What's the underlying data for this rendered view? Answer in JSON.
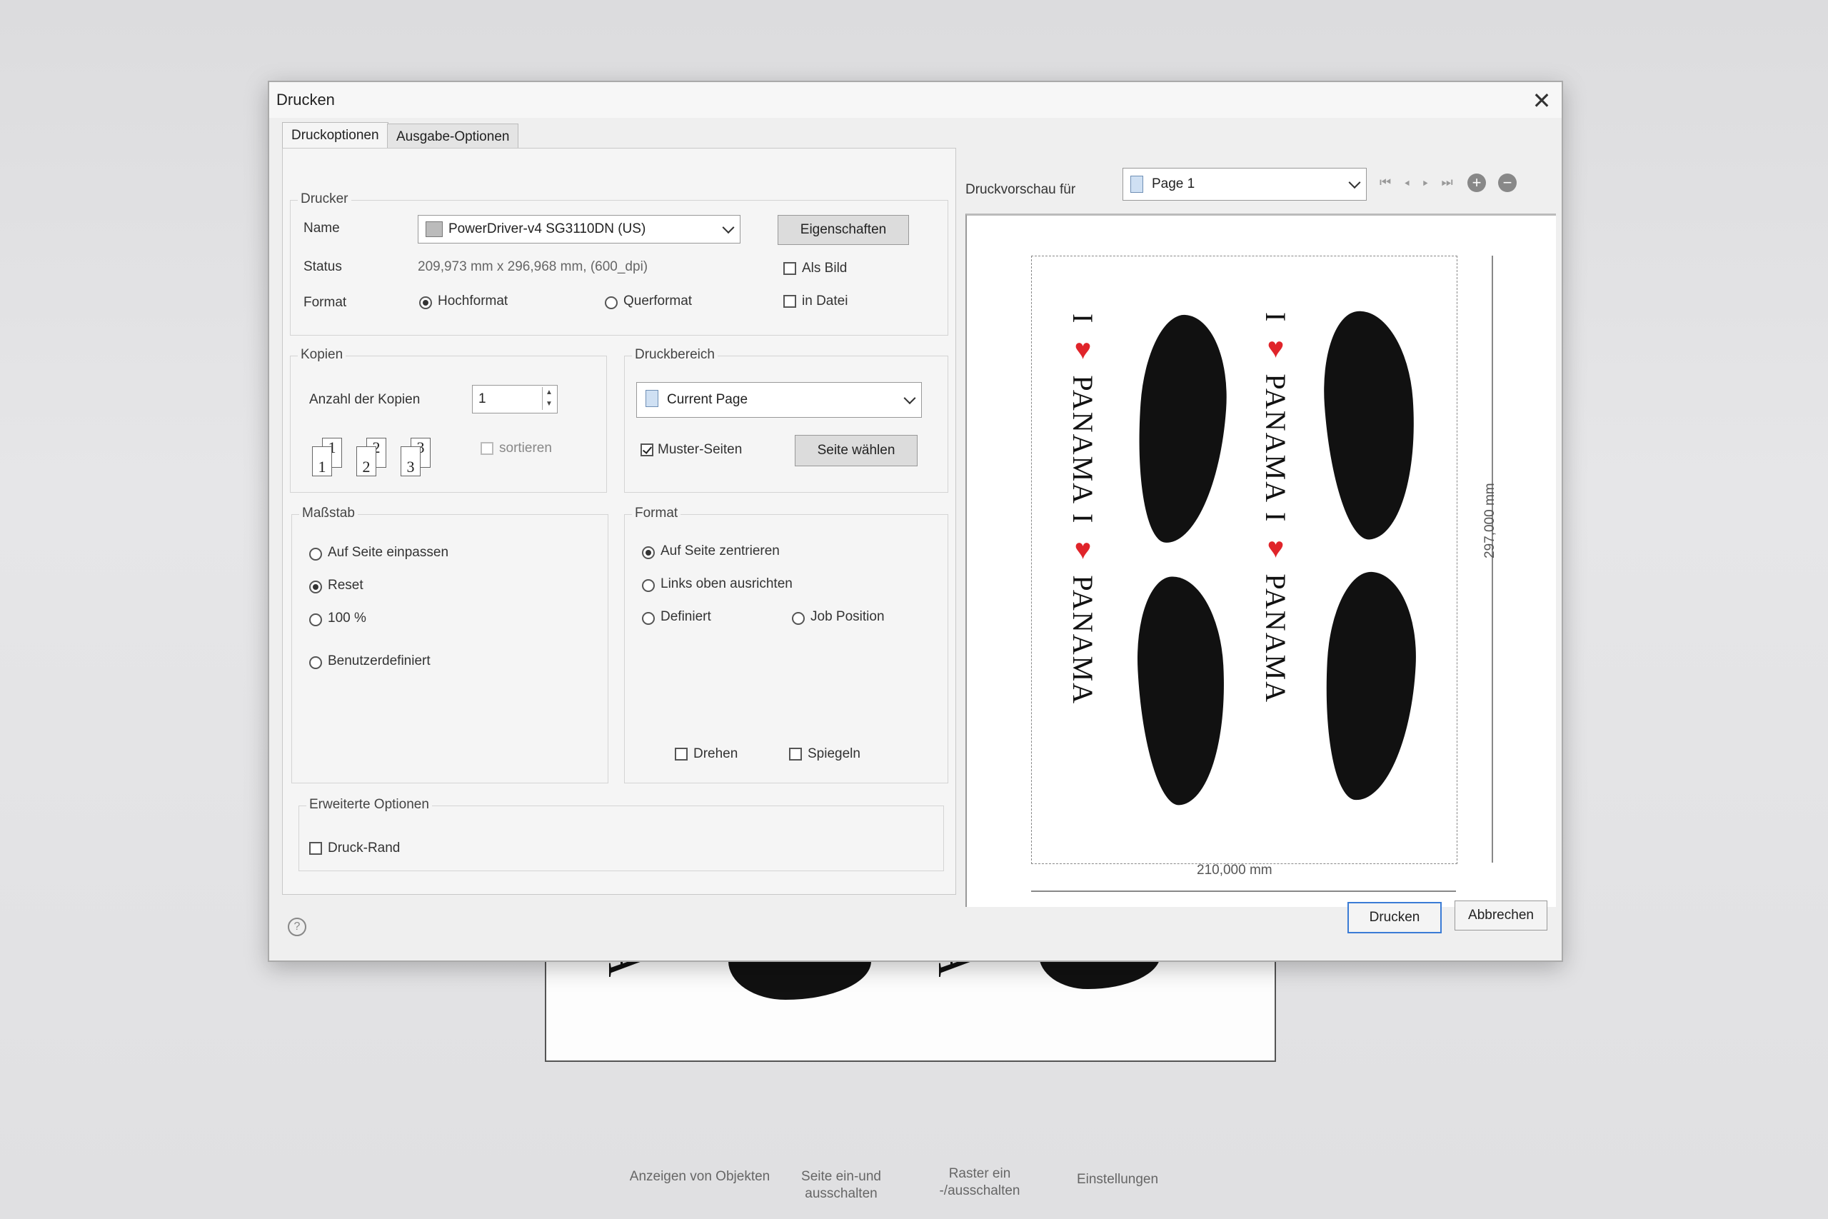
{
  "dialog": {
    "title": "Drucken",
    "tabs": [
      "Druckoptionen",
      "Ausgabe-Optionen"
    ],
    "printer": {
      "group": "Drucker",
      "name_label": "Name",
      "name_value": "PowerDriver-v4 SG3110DN (US)",
      "properties_button": "Eigenschaften",
      "status_label": "Status",
      "status_value": "209,973 mm x 296,968 mm, (600_dpi)",
      "as_image": "Als Bild",
      "to_file": "in Datei",
      "format_label": "Format",
      "portrait": "Hochformat",
      "landscape": "Querformat"
    },
    "copies": {
      "group": "Kopien",
      "count_label": "Anzahl der Kopien",
      "count_value": "1",
      "sort": "sortieren",
      "icon_digits": [
        "1",
        "1",
        "2",
        "2",
        "3",
        "3"
      ]
    },
    "print_range": {
      "group": "Druckbereich",
      "selection": "Current Page",
      "pattern_pages": "Muster-Seiten",
      "select_page_button": "Seite wählen"
    },
    "scale": {
      "group": "Maßstab",
      "fit": "Auf Seite einpassen",
      "reset": "Reset",
      "pct100": "100 %",
      "custom": "Benutzerdefiniert"
    },
    "format": {
      "group": "Format",
      "center": "Auf Seite zentrieren",
      "top_left": "Links oben ausrichten",
      "defined": "Definiert",
      "job_position": "Job Position",
      "rotate": "Drehen",
      "mirror": "Spiegeln"
    },
    "advanced": {
      "group": "Erweiterte Optionen",
      "print_border": "Druck-Rand"
    },
    "preview": {
      "label": "Druckvorschau für",
      "page_select": "Page 1",
      "width_dim": "210,000 mm",
      "height_dim": "297,000 mm",
      "artwork_text": "I ♥ PANAMA",
      "artwork_word": "PANAMA",
      "heart_color": "#e0242a"
    },
    "buttons": {
      "print": "Drucken",
      "cancel": "Abbrechen",
      "help": "?"
    }
  },
  "background": {
    "canvas_text": "A",
    "toolbar": [
      "Anzeigen von Objekten",
      "Seite ein-und ausschalten",
      "Raster ein -/ausschalten",
      "Einstellungen"
    ]
  }
}
